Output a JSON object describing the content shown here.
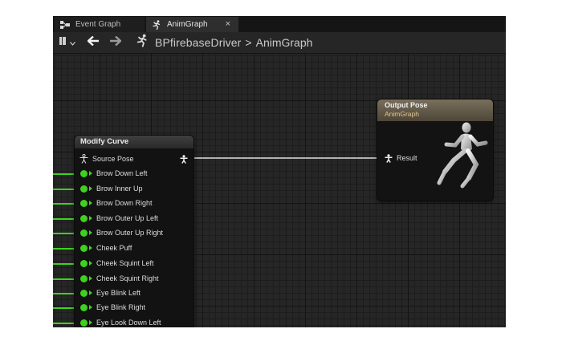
{
  "tabs": [
    {
      "label": "Event Graph",
      "icon": "event-graph-icon",
      "active": false
    },
    {
      "label": "AnimGraph",
      "icon": "running-man-icon",
      "active": true,
      "close": "×"
    }
  ],
  "toolbar": {
    "breadcrumb_parent": "BPfirebaseDriver",
    "breadcrumb_separator": ">",
    "breadcrumb_current": "AnimGraph"
  },
  "nodes": {
    "modify_curve": {
      "title": "Modify Curve",
      "source_pin": "Source Pose",
      "pins": [
        "Brow Down Left",
        "Brow Inner Up",
        "Brow Down Right",
        "Brow Outer Up Left",
        "Brow Outer Up Right",
        "Cheek Puff",
        "Cheek Squint Left",
        "Cheek Squint Right",
        "Eye Blink Left",
        "Eye Blink Right",
        "Eye Look Down Left"
      ]
    },
    "output_pose": {
      "title": "Output Pose",
      "subtitle": "AnimGraph",
      "result_pin": "Result"
    }
  },
  "colors": {
    "float_pin": "#3ed21f",
    "output_header": "#7a6f5c",
    "output_subtitle": "#e3c48b",
    "graph_bg": "#262626"
  }
}
